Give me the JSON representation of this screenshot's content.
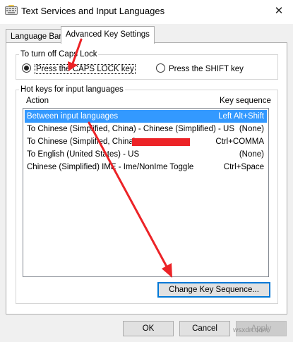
{
  "window": {
    "title": "Text Services and Input Languages",
    "close_glyph": "✕"
  },
  "tabs": [
    {
      "label": "Language Bar",
      "selected": false
    },
    {
      "label": "Advanced Key Settings",
      "selected": true
    }
  ],
  "caps_lock": {
    "group_label": "To turn off Caps Lock",
    "options": [
      {
        "label": "Press the CAPS LOCK key",
        "selected": true
      },
      {
        "label": "Press the SHIFT key",
        "selected": false
      }
    ]
  },
  "hotkeys": {
    "group_label": "Hot keys for input languages",
    "columns": {
      "action": "Action",
      "key_sequence": "Key sequence"
    },
    "rows": [
      {
        "action": "Between input languages",
        "key": "Left Alt+Shift",
        "selected": true
      },
      {
        "action": "To Chinese (Simplified, China) - Chinese (Simplified) - US",
        "key": "(None)",
        "selected": false
      },
      {
        "action": "To Chinese (Simplified, China) -",
        "key": "Ctrl+COMMA",
        "selected": false,
        "redacted": true
      },
      {
        "action": "To English (United States) - US",
        "key": "(None)",
        "selected": false
      },
      {
        "action": "Chinese (Simplified) IME - Ime/NonIme Toggle",
        "key": "Ctrl+Space",
        "selected": false
      }
    ],
    "change_button": "Change Key Sequence..."
  },
  "buttons": {
    "ok": "OK",
    "cancel": "Cancel",
    "apply": "Apply"
  },
  "colors": {
    "selection": "#3399ff",
    "arrow": "#ec2327",
    "focus_border": "#0078d7"
  },
  "watermark": "wsxdn.com"
}
